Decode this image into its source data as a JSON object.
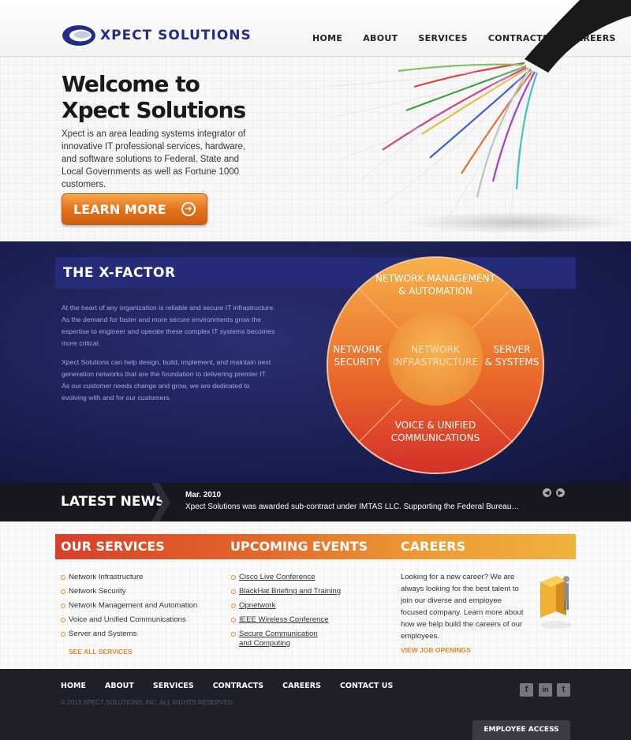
{
  "colors": {
    "brand_blue": "#232d86",
    "accent_orange": "#e2701a",
    "navy": "#181c4c",
    "footer": "#1e1f29"
  },
  "header": {
    "logo_text": "XPECT SOLUTIONS",
    "nav": [
      "HOME",
      "ABOUT",
      "SERVICES",
      "CONTRACTS",
      "CAREERS"
    ]
  },
  "hero": {
    "title_line1": "Welcome to",
    "title_line2": "Xpect Solutions",
    "text": "Xpect is an area leading systems integrator of innovative IT professional services, hardware, and software solutions to Federal, State and Local Governments as well as Fortune 1000 customers.",
    "button": "LEARN MORE",
    "button_icon": "arrow-circle-right-icon"
  },
  "xfactor": {
    "title": "THE X-FACTOR",
    "p1": "At the heart of any organization is reliable and secure IT infrastructure. As the demand for faster and more secure environments grow the expertise to engineer and operate these complex IT systems becomes more critical.",
    "p2": "Xpect Solutions can help design, build, implement, and maintain next generation networks that are the foundation to delivering premier IT. As our customer needs change and grow, we are dedicated to evolving with and for our customers.",
    "circle": {
      "top": [
        "NETWORK MANAGEMENT",
        "& AUTOMATION"
      ],
      "left": [
        "NETWORK",
        "SECURITY"
      ],
      "center": [
        "NETWORK",
        "INFRASTRUCTURE"
      ],
      "right": [
        "SERVER",
        "& SYSTEMS"
      ],
      "bottom": [
        "VOICE & UNIFIED",
        "COMMUNICATIONS"
      ]
    }
  },
  "news": {
    "title": "LATEST NEWS",
    "date": "Mar. 2010",
    "text": "Xpect Solutions was awarded sub-contract under IMTAS LLC. Supporting the Federal Bureau…",
    "prev_icon": "arrow-left-icon",
    "next_icon": "arrow-right-icon"
  },
  "services": {
    "title": "OUR SERVICES",
    "items": [
      "Network Infrastructure",
      "Network Security",
      "Network Management and Automation",
      "Voice and Unified Communications",
      "Server and Systems"
    ],
    "link": "SEE ALL SERVICES"
  },
  "events": {
    "title": "UPCOMING EVENTS",
    "items": [
      "Cisco Live Conference",
      "BlackHat Briefing and Training",
      "Opnetwork",
      "IEEE Wireless Conference",
      "Secure Communication and Computing"
    ]
  },
  "careers": {
    "title": "CAREERS",
    "text": "Looking for a new career? We are always looking for the best talent to join our diverse and employee focused company. Learn more about how we help build the careers of our employees.",
    "link": "VIEW JOB OPENINGS"
  },
  "footer": {
    "nav": [
      "HOME",
      "ABOUT",
      "SERVICES",
      "CONTRACTS",
      "CAREERS",
      "CONTACT US"
    ],
    "copyright": "© 2013 XPECT SOLUTIONS, INC. ALL RIGHTS RESERVED.",
    "social": [
      {
        "icon": "facebook-icon",
        "glyph": "f"
      },
      {
        "icon": "linkedin-icon",
        "glyph": "in"
      },
      {
        "icon": "twitter-icon",
        "glyph": "t"
      }
    ],
    "employee_access": "EMPLOYEE ACCESS"
  }
}
